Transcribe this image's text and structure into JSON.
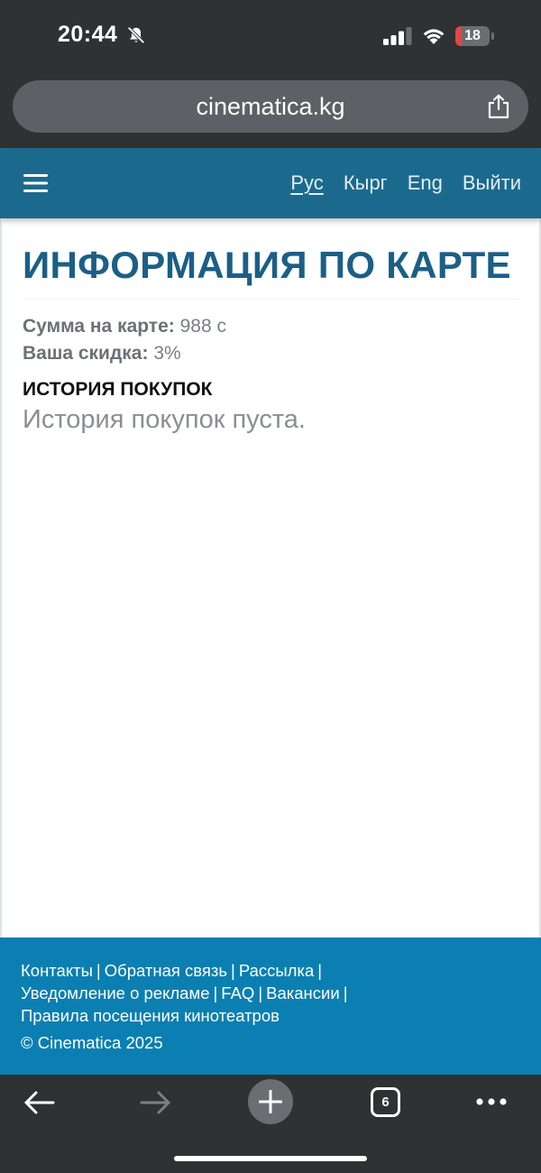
{
  "status_bar": {
    "time": "20:44",
    "battery_level": "18",
    "battery_fraction": 0.18,
    "icons": [
      "bell-off-icon",
      "signal-icon",
      "wifi-icon",
      "battery-icon"
    ]
  },
  "browser": {
    "url": "cinematica.kg",
    "share_icon": "share-icon"
  },
  "header": {
    "menu_icon": "hamburger-menu-icon",
    "languages": [
      {
        "label": "Рус",
        "active": true
      },
      {
        "label": "Кырг",
        "active": false
      },
      {
        "label": "Eng",
        "active": false
      }
    ],
    "logout_label": "Выйти",
    "bg_color": "#1b6a8e"
  },
  "main": {
    "title": "ИНФОРМАЦИЯ ПО КАРТЕ",
    "title_color": "#1b5f86",
    "balance_label": "Сумма на карте:",
    "balance_value": "988 с",
    "discount_label": "Ваша скидка:",
    "discount_value": "3%",
    "history_title": "ИСТОРИЯ ПОКУПОК",
    "history_empty": "История покупок пуста."
  },
  "footer": {
    "bg_color": "#0b7fb1",
    "links": [
      "Контакты",
      "Обратная связь",
      "Рассылка",
      "Уведомление о рекламе",
      "FAQ",
      "Вакансии",
      "Правила посещения кинотеатров"
    ],
    "separator": "|",
    "copyright": "© Cinematica 2025"
  },
  "toolbar": {
    "tab_count": "6",
    "icons": [
      "back-arrow-icon",
      "forward-arrow-icon",
      "new-tab-plus-icon",
      "tabs-icon",
      "more-dots-icon"
    ]
  }
}
